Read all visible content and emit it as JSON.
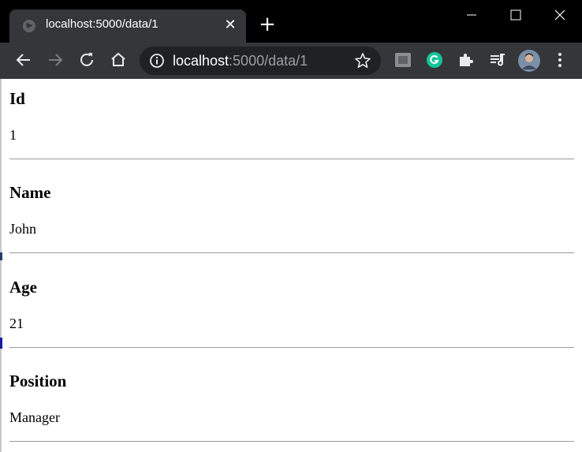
{
  "browser": {
    "tab_title": "localhost:5000/data/1",
    "tab_close": "✕",
    "new_tab": "+",
    "url_host": "localhost",
    "url_path": ":5000/data/1"
  },
  "record": [
    {
      "label": "Id",
      "value": "1"
    },
    {
      "label": "Name",
      "value": "John"
    },
    {
      "label": "Age",
      "value": "21"
    },
    {
      "label": "Position",
      "value": "Manager"
    }
  ]
}
